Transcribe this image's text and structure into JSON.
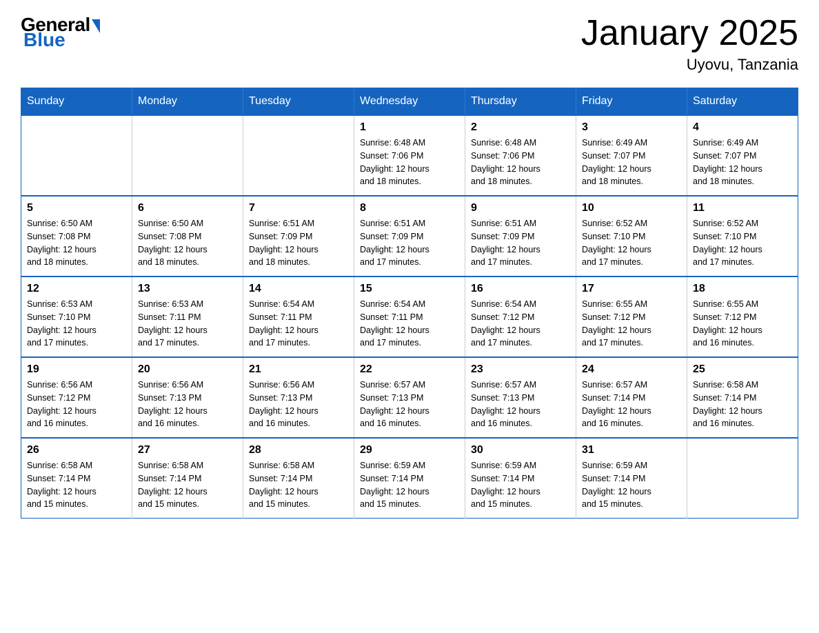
{
  "logo": {
    "general": "General",
    "blue": "Blue"
  },
  "title": "January 2025",
  "subtitle": "Uyovu, Tanzania",
  "days": [
    "Sunday",
    "Monday",
    "Tuesday",
    "Wednesday",
    "Thursday",
    "Friday",
    "Saturday"
  ],
  "weeks": [
    [
      {
        "day": "",
        "info": ""
      },
      {
        "day": "",
        "info": ""
      },
      {
        "day": "",
        "info": ""
      },
      {
        "day": "1",
        "info": "Sunrise: 6:48 AM\nSunset: 7:06 PM\nDaylight: 12 hours\nand 18 minutes."
      },
      {
        "day": "2",
        "info": "Sunrise: 6:48 AM\nSunset: 7:06 PM\nDaylight: 12 hours\nand 18 minutes."
      },
      {
        "day": "3",
        "info": "Sunrise: 6:49 AM\nSunset: 7:07 PM\nDaylight: 12 hours\nand 18 minutes."
      },
      {
        "day": "4",
        "info": "Sunrise: 6:49 AM\nSunset: 7:07 PM\nDaylight: 12 hours\nand 18 minutes."
      }
    ],
    [
      {
        "day": "5",
        "info": "Sunrise: 6:50 AM\nSunset: 7:08 PM\nDaylight: 12 hours\nand 18 minutes."
      },
      {
        "day": "6",
        "info": "Sunrise: 6:50 AM\nSunset: 7:08 PM\nDaylight: 12 hours\nand 18 minutes."
      },
      {
        "day": "7",
        "info": "Sunrise: 6:51 AM\nSunset: 7:09 PM\nDaylight: 12 hours\nand 18 minutes."
      },
      {
        "day": "8",
        "info": "Sunrise: 6:51 AM\nSunset: 7:09 PM\nDaylight: 12 hours\nand 17 minutes."
      },
      {
        "day": "9",
        "info": "Sunrise: 6:51 AM\nSunset: 7:09 PM\nDaylight: 12 hours\nand 17 minutes."
      },
      {
        "day": "10",
        "info": "Sunrise: 6:52 AM\nSunset: 7:10 PM\nDaylight: 12 hours\nand 17 minutes."
      },
      {
        "day": "11",
        "info": "Sunrise: 6:52 AM\nSunset: 7:10 PM\nDaylight: 12 hours\nand 17 minutes."
      }
    ],
    [
      {
        "day": "12",
        "info": "Sunrise: 6:53 AM\nSunset: 7:10 PM\nDaylight: 12 hours\nand 17 minutes."
      },
      {
        "day": "13",
        "info": "Sunrise: 6:53 AM\nSunset: 7:11 PM\nDaylight: 12 hours\nand 17 minutes."
      },
      {
        "day": "14",
        "info": "Sunrise: 6:54 AM\nSunset: 7:11 PM\nDaylight: 12 hours\nand 17 minutes."
      },
      {
        "day": "15",
        "info": "Sunrise: 6:54 AM\nSunset: 7:11 PM\nDaylight: 12 hours\nand 17 minutes."
      },
      {
        "day": "16",
        "info": "Sunrise: 6:54 AM\nSunset: 7:12 PM\nDaylight: 12 hours\nand 17 minutes."
      },
      {
        "day": "17",
        "info": "Sunrise: 6:55 AM\nSunset: 7:12 PM\nDaylight: 12 hours\nand 17 minutes."
      },
      {
        "day": "18",
        "info": "Sunrise: 6:55 AM\nSunset: 7:12 PM\nDaylight: 12 hours\nand 16 minutes."
      }
    ],
    [
      {
        "day": "19",
        "info": "Sunrise: 6:56 AM\nSunset: 7:12 PM\nDaylight: 12 hours\nand 16 minutes."
      },
      {
        "day": "20",
        "info": "Sunrise: 6:56 AM\nSunset: 7:13 PM\nDaylight: 12 hours\nand 16 minutes."
      },
      {
        "day": "21",
        "info": "Sunrise: 6:56 AM\nSunset: 7:13 PM\nDaylight: 12 hours\nand 16 minutes."
      },
      {
        "day": "22",
        "info": "Sunrise: 6:57 AM\nSunset: 7:13 PM\nDaylight: 12 hours\nand 16 minutes."
      },
      {
        "day": "23",
        "info": "Sunrise: 6:57 AM\nSunset: 7:13 PM\nDaylight: 12 hours\nand 16 minutes."
      },
      {
        "day": "24",
        "info": "Sunrise: 6:57 AM\nSunset: 7:14 PM\nDaylight: 12 hours\nand 16 minutes."
      },
      {
        "day": "25",
        "info": "Sunrise: 6:58 AM\nSunset: 7:14 PM\nDaylight: 12 hours\nand 16 minutes."
      }
    ],
    [
      {
        "day": "26",
        "info": "Sunrise: 6:58 AM\nSunset: 7:14 PM\nDaylight: 12 hours\nand 15 minutes."
      },
      {
        "day": "27",
        "info": "Sunrise: 6:58 AM\nSunset: 7:14 PM\nDaylight: 12 hours\nand 15 minutes."
      },
      {
        "day": "28",
        "info": "Sunrise: 6:58 AM\nSunset: 7:14 PM\nDaylight: 12 hours\nand 15 minutes."
      },
      {
        "day": "29",
        "info": "Sunrise: 6:59 AM\nSunset: 7:14 PM\nDaylight: 12 hours\nand 15 minutes."
      },
      {
        "day": "30",
        "info": "Sunrise: 6:59 AM\nSunset: 7:14 PM\nDaylight: 12 hours\nand 15 minutes."
      },
      {
        "day": "31",
        "info": "Sunrise: 6:59 AM\nSunset: 7:14 PM\nDaylight: 12 hours\nand 15 minutes."
      },
      {
        "day": "",
        "info": ""
      }
    ]
  ]
}
